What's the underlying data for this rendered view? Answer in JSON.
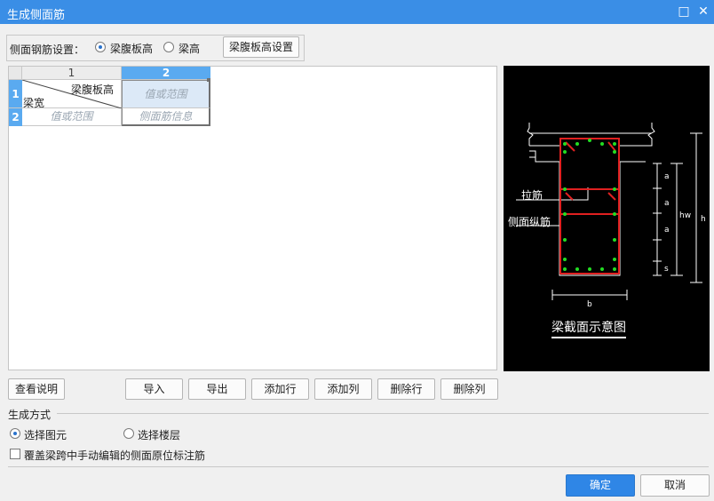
{
  "window": {
    "title": "生成侧面筋",
    "maximize_glyph": "□",
    "close_glyph": "✕"
  },
  "settings": {
    "label": "侧面钢筋设置：",
    "option_web_height": "梁腹板高",
    "option_beam_height": "梁高",
    "selected": "梁腹板高",
    "config_button": "梁腹板高设置"
  },
  "grid": {
    "col_headers": [
      "1",
      "2"
    ],
    "row_headers": [
      "1",
      "2"
    ],
    "header_cell_top": "梁腹板高",
    "header_cell_bottom": "梁宽",
    "placeholder_value_range": "值或范围",
    "placeholder_rebar_info": "侧面筋信息"
  },
  "diagram": {
    "caption": "梁截面示意图",
    "label_tie": "拉筋",
    "label_side_bar": "侧面纵筋",
    "dim_a": "a",
    "dim_b": "b",
    "dim_s": "s",
    "dim_hw": "hw",
    "dim_h": "h",
    "colors": {
      "stirrup": "#e02020",
      "bar": "#22dd22",
      "line": "#ffffff",
      "bg": "#000000"
    }
  },
  "toolbar": {
    "help": "查看说明",
    "import": "导入",
    "export": "导出",
    "add_row": "添加行",
    "add_col": "添加列",
    "del_row": "删除行",
    "del_col": "删除列"
  },
  "generate": {
    "section_title": "生成方式",
    "option_select_element": "选择图元",
    "option_select_floor": "选择楼层",
    "selected": "选择图元",
    "overwrite_checkbox": "覆盖梁跨中手动编辑的侧面原位标注筋",
    "overwrite_checked": false
  },
  "footer": {
    "ok": "确定",
    "cancel": "取消"
  }
}
